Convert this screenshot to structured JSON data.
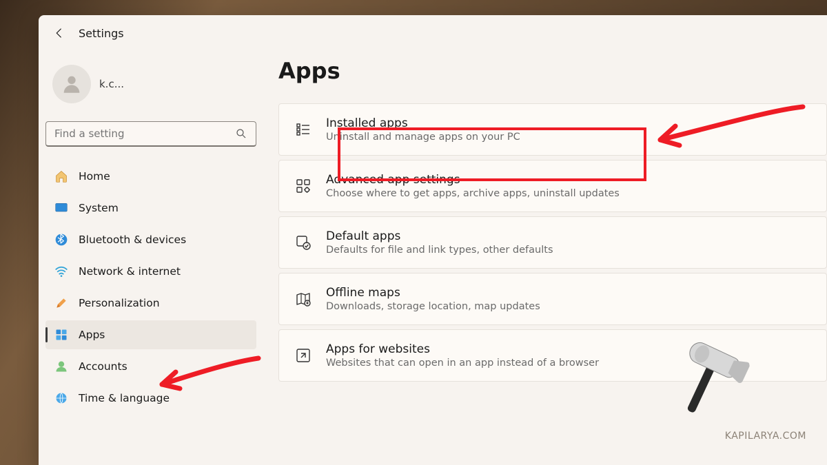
{
  "window": {
    "title": "Settings"
  },
  "account": {
    "email_trunc": "k.c..."
  },
  "search": {
    "placeholder": "Find a setting"
  },
  "nav": [
    {
      "label": "Home",
      "icon": "home-icon"
    },
    {
      "label": "System",
      "icon": "system-icon"
    },
    {
      "label": "Bluetooth & devices",
      "icon": "bluetooth-icon"
    },
    {
      "label": "Network & internet",
      "icon": "network-icon"
    },
    {
      "label": "Personalization",
      "icon": "personalization-icon"
    },
    {
      "label": "Apps",
      "icon": "apps-icon",
      "selected": true
    },
    {
      "label": "Accounts",
      "icon": "accounts-icon"
    },
    {
      "label": "Time & language",
      "icon": "time-language-icon"
    }
  ],
  "page": {
    "title": "Apps"
  },
  "cards": [
    {
      "title": "Installed apps",
      "sub": "Uninstall and manage apps on your PC",
      "icon": "installed-apps-icon",
      "highlight": true
    },
    {
      "title": "Advanced app settings",
      "sub": "Choose where to get apps, archive apps, uninstall updates",
      "icon": "advanced-icon"
    },
    {
      "title": "Default apps",
      "sub": "Defaults for file and link types, other defaults",
      "icon": "default-apps-icon"
    },
    {
      "title": "Offline maps",
      "sub": "Downloads, storage location, map updates",
      "icon": "offline-maps-icon"
    },
    {
      "title": "Apps for websites",
      "sub": "Websites that can open in an app instead of a browser",
      "icon": "apps-websites-icon"
    }
  ],
  "annotation": {
    "watermark": "KAPILARYA.COM",
    "highlight_color": "#ee1c25",
    "arrow_color": "#ee1c25"
  }
}
